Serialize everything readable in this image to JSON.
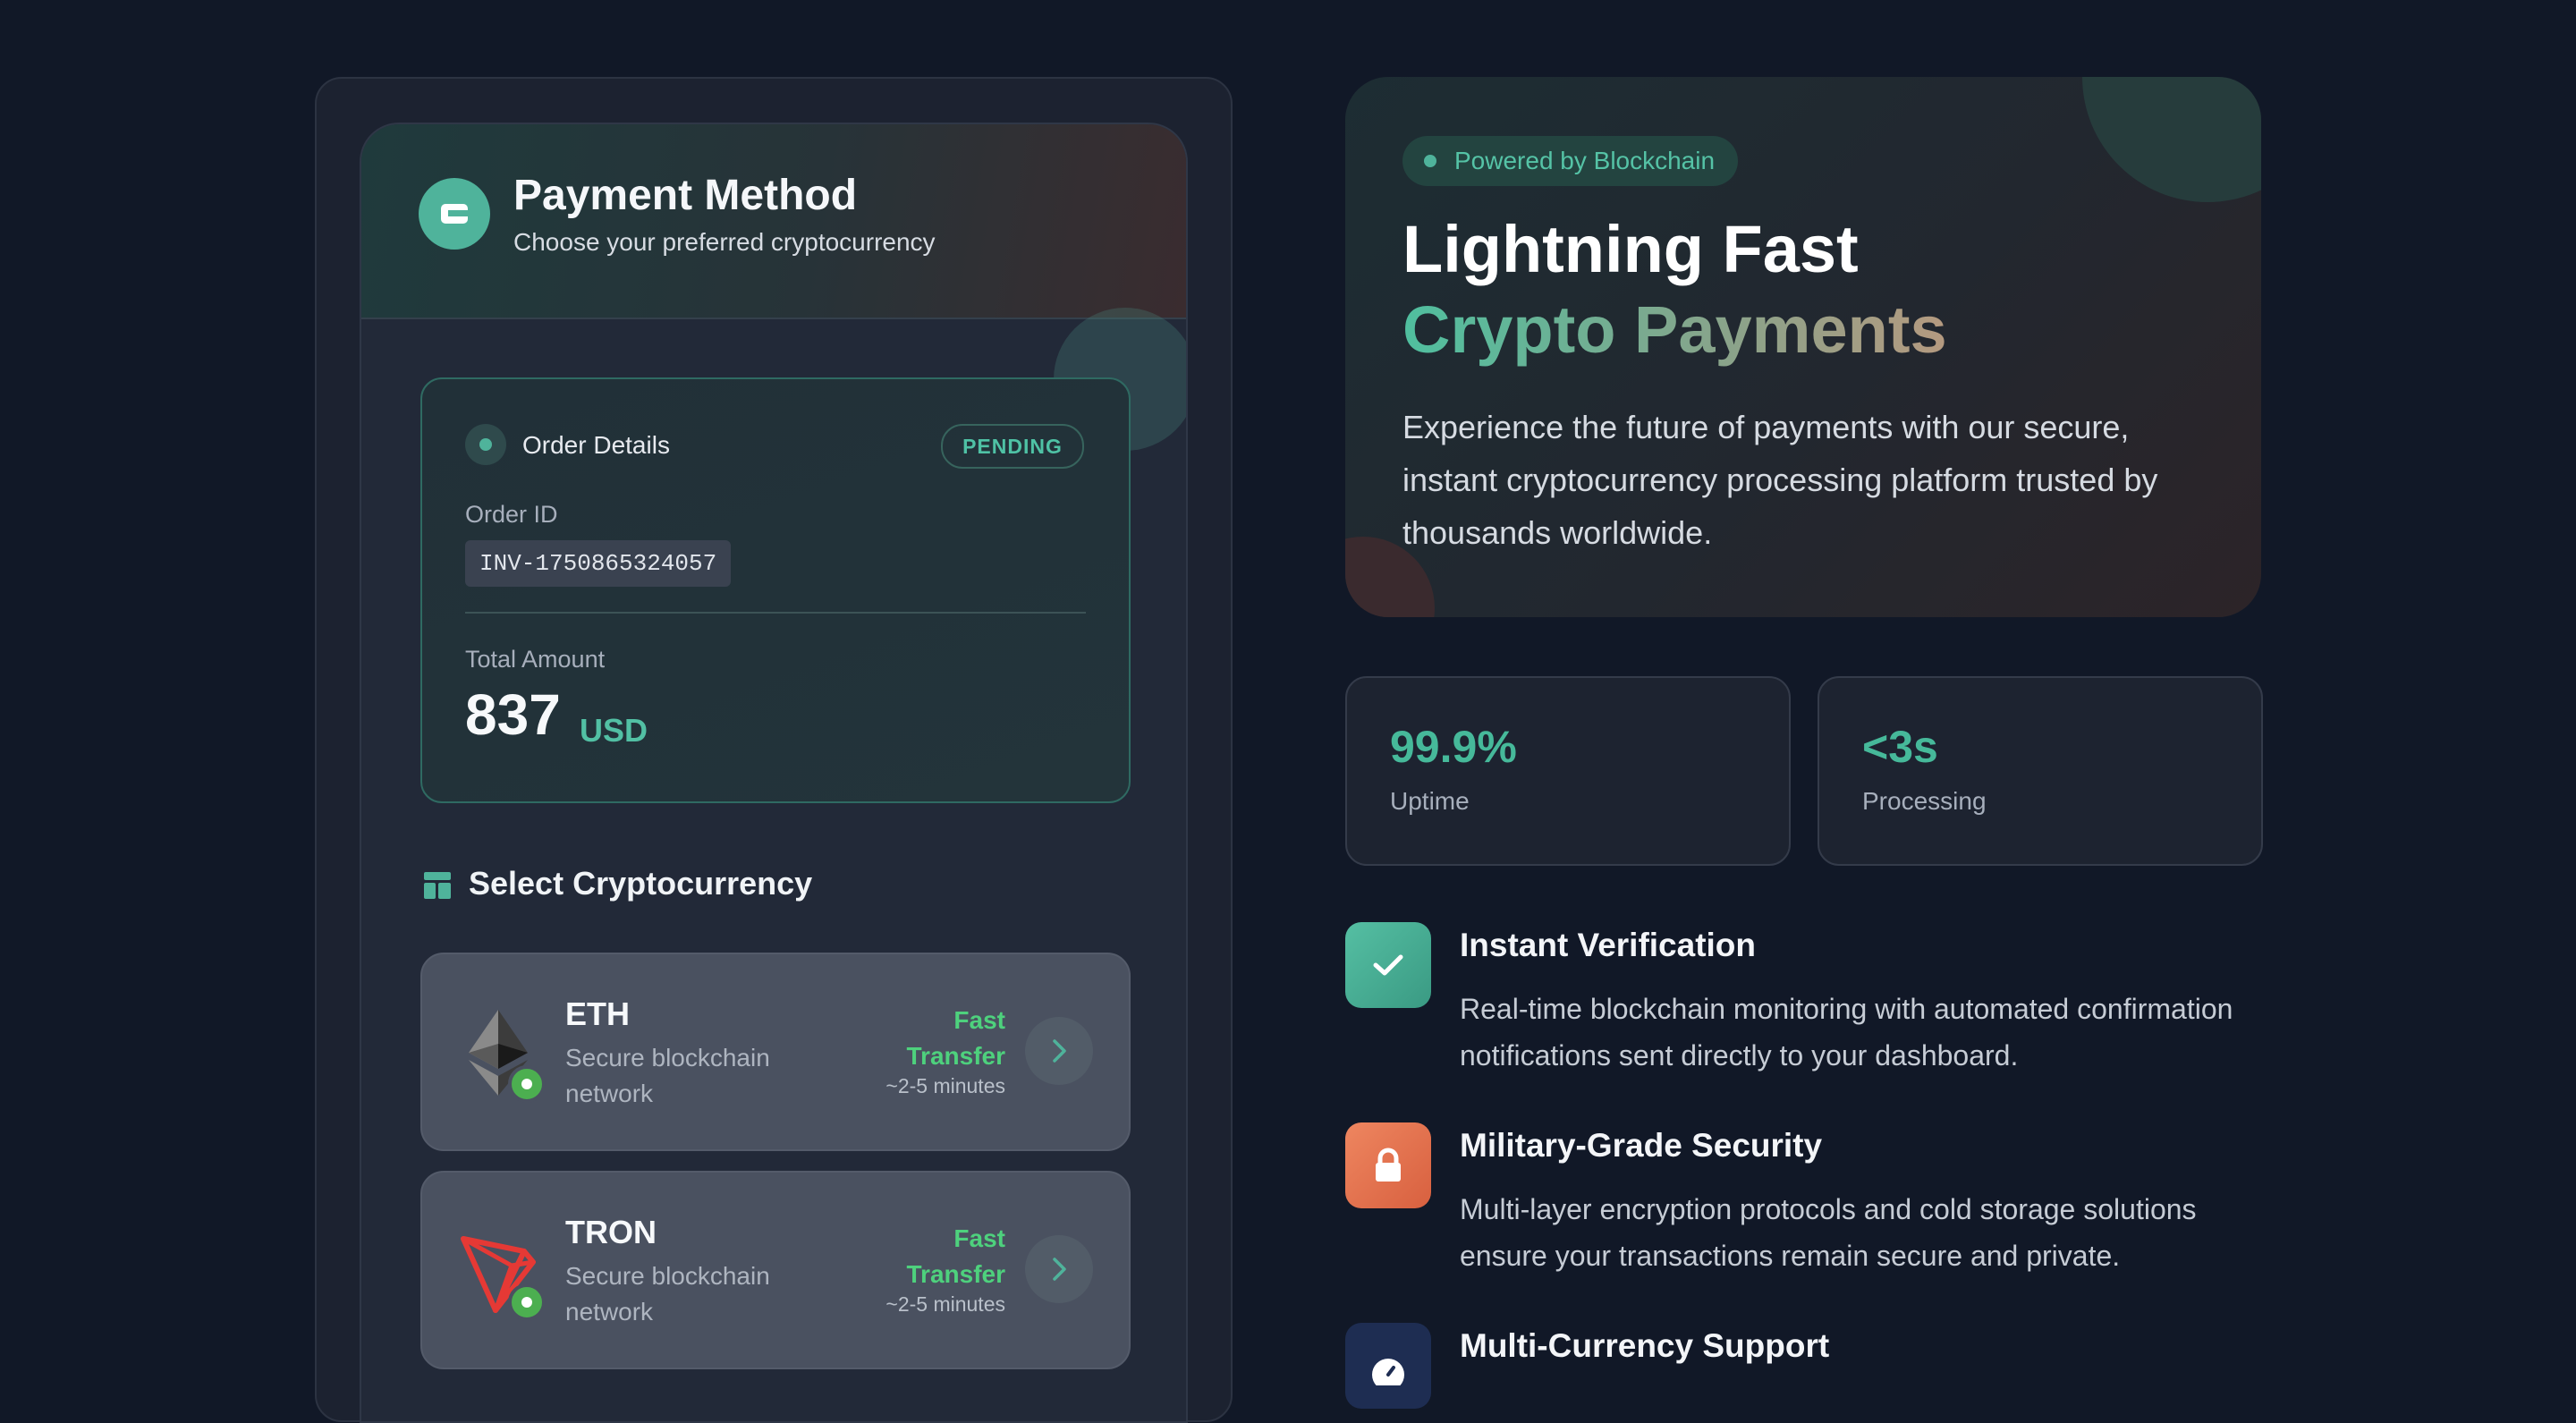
{
  "payment": {
    "title": "Payment Method",
    "subtitle": "Choose your preferred cryptocurrency"
  },
  "order": {
    "label": "Order Details",
    "status": "PENDING",
    "id_label": "Order ID",
    "id_value": "INV-1750865324057",
    "total_label": "Total Amount",
    "total_value": "837",
    "currency": "USD"
  },
  "select": {
    "title": "Select Cryptocurrency",
    "items": [
      {
        "name": "ETH",
        "desc": "Secure blockchain network",
        "speed": "Fast Transfer",
        "time": "~2-5 minutes",
        "icon": "ethereum-logo-icon"
      },
      {
        "name": "TRON",
        "desc": "Secure blockchain network",
        "speed": "Fast Transfer",
        "time": "~2-5 minutes",
        "icon": "tron-logo-icon"
      }
    ]
  },
  "hero": {
    "pill": "Powered by Blockchain",
    "title_line1": "Lightning Fast",
    "title_line2": "Crypto Payments",
    "description": "Experience the future of payments with our secure, instant cryptocurrency processing platform trusted by thousands worldwide."
  },
  "stats": [
    {
      "value": "99.9%",
      "label": "Uptime"
    },
    {
      "value": "<3s",
      "label": "Processing"
    }
  ],
  "features": [
    {
      "title": "Instant Verification",
      "desc": "Real-time blockchain monitoring with automated confirmation notifications sent directly to your dashboard.",
      "icon": "check-icon",
      "color": "#4fb39b"
    },
    {
      "title": "Military-Grade Security",
      "desc": "Multi-layer encryption protocols and cold storage solutions ensure your transactions remain secure and private.",
      "icon": "lock-icon",
      "color": "#e0704f"
    },
    {
      "title": "Multi-Currency Support",
      "desc": "",
      "icon": "clock-icon",
      "color": "#1e2d52"
    }
  ],
  "colors": {
    "accent": "#4fb39b",
    "background": "#111827",
    "success": "#4ed17d",
    "warning": "#e0704f"
  }
}
